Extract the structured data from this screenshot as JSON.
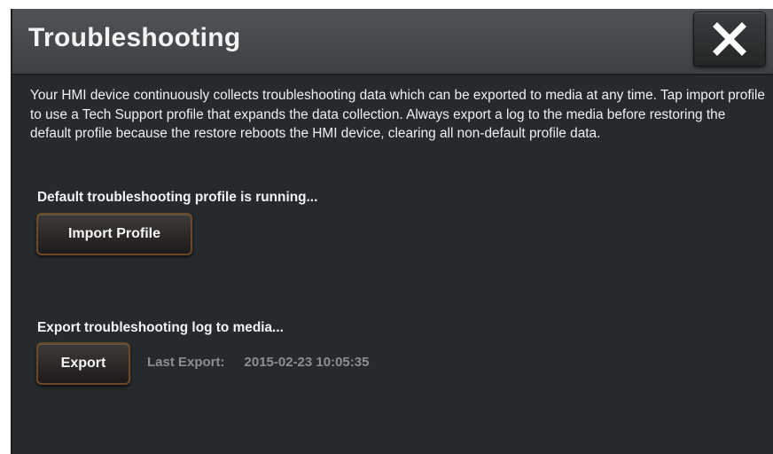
{
  "dialog": {
    "title": "Troubleshooting",
    "close_icon": "close-icon"
  },
  "description": "Your HMI device continuously collects troubleshooting data which can be exported to media at any time. Tap import profile to use a Tech Support profile that expands the data collection. Always export a log to the media before restoring the default profile because the restore reboots the HMI device, clearing all non-default profile data.",
  "profile_section": {
    "status": "Default troubleshooting profile is running...",
    "import_button": "Import Profile"
  },
  "export_section": {
    "label": "Export troubleshooting log to media...",
    "export_button": "Export",
    "last_export_label": "Last Export:",
    "last_export_value": "2015-02-23 10:05:35"
  },
  "colors": {
    "background": "#262a2c",
    "titlebar": "#45494c",
    "button_border": "#6b4a2c",
    "muted_text": "#8c8f91"
  }
}
